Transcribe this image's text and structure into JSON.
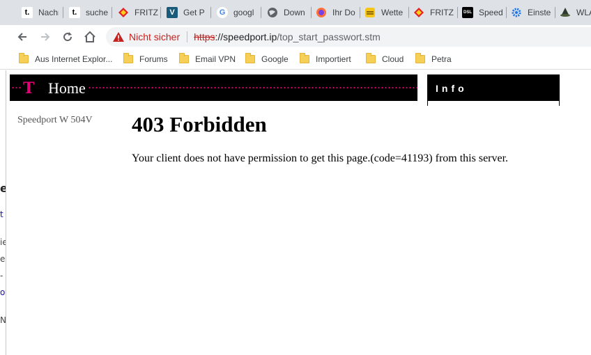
{
  "tabs": [
    {
      "title": "Nachr",
      "icon": "t-online-icon",
      "favicon_text": "t."
    },
    {
      "title": "suche",
      "icon": "t-online-icon",
      "favicon_text": "t."
    },
    {
      "title": "FRITZ",
      "icon": "fritzbox-icon"
    },
    {
      "title": "Get P",
      "icon": "v-logo-icon",
      "favicon_text": "V"
    },
    {
      "title": "googl",
      "icon": "google-icon",
      "favicon_text": "G"
    },
    {
      "title": "Down",
      "icon": "globe-icon"
    },
    {
      "title": "Ihr Do",
      "icon": "firefox-icon"
    },
    {
      "title": "Wette",
      "icon": "weather-icon"
    },
    {
      "title": "FRITZ",
      "icon": "fritzbox-icon"
    },
    {
      "title": "Speed",
      "icon": "dsl-forum-icon",
      "favicon_text": "DSL"
    },
    {
      "title": "Einste",
      "icon": "gear-icon"
    },
    {
      "title": "WLA",
      "icon": "wizard-icon"
    }
  ],
  "toolbar": {
    "security_label": "Nicht sicher",
    "url_scheme": "https",
    "url_host": "://speedport.ip",
    "url_path": "/top_start_passwort.stm"
  },
  "bookmarks": [
    {
      "label": "Aus Internet Explor..."
    },
    {
      "label": "Forums"
    },
    {
      "label": "Email VPN"
    },
    {
      "label": "Google"
    },
    {
      "label": "Importiert"
    },
    {
      "label": "Cloud"
    },
    {
      "label": "Petra"
    }
  ],
  "page": {
    "home_logo": "T",
    "home_label": "Home",
    "info_label": "Info",
    "device_name": "Speedport W 504V",
    "error_title": "403 Forbidden",
    "error_message": "Your client does not have permission to get this page.(code=41193) from this server."
  },
  "left_fragments": [
    "e",
    "t",
    "ie",
    "e",
    "-",
    "ov",
    "N"
  ],
  "colors": {
    "telekom_magenta": "#e20074",
    "insecure_red": "#c5221f",
    "tabstrip_bg": "#dee1e6"
  }
}
